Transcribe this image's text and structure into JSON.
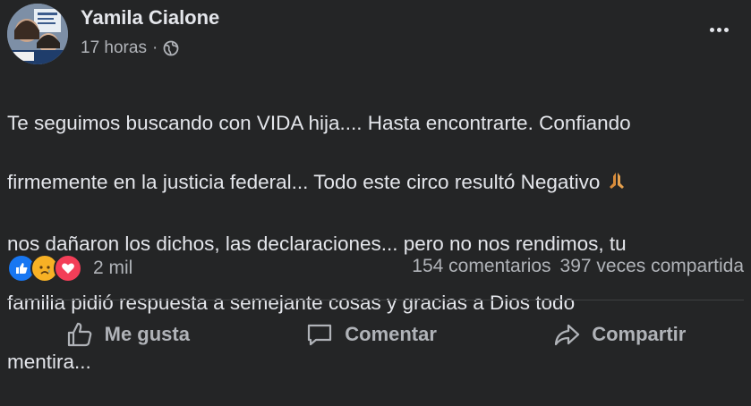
{
  "post": {
    "author": "Yamila Cialone",
    "time": "17 horas",
    "separator": "·",
    "privacy_icon": "globe-icon",
    "lines": [
      "Te seguimos buscando con VIDA hija....  Hasta encontrarte. Confiando",
      "firmemente en la justicia federal... Todo este circo resultó Negativo",
      "nos dañaron los dichos, las declaraciones... pero  no nos rendimos, tu",
      "familia pidió  respuesta a semejante cosas y gracias a Dios todo",
      "mentira..."
    ],
    "emoji_icon": "praying-hands-icon"
  },
  "reactions": {
    "icons": [
      "like-reaction-icon",
      "sad-reaction-icon",
      "love-reaction-icon"
    ],
    "count": "2 mil",
    "comments": "154 comentarios",
    "shares": "397 veces compartida"
  },
  "actions": {
    "like": "Me gusta",
    "comment": "Comentar",
    "share": "Compartir"
  },
  "colors": {
    "background": "#242526",
    "text": "#e4e6eb",
    "secondary": "#b0b3b8",
    "like": "#1877f2",
    "love": "#f33e58",
    "sad": "#f7b125"
  }
}
